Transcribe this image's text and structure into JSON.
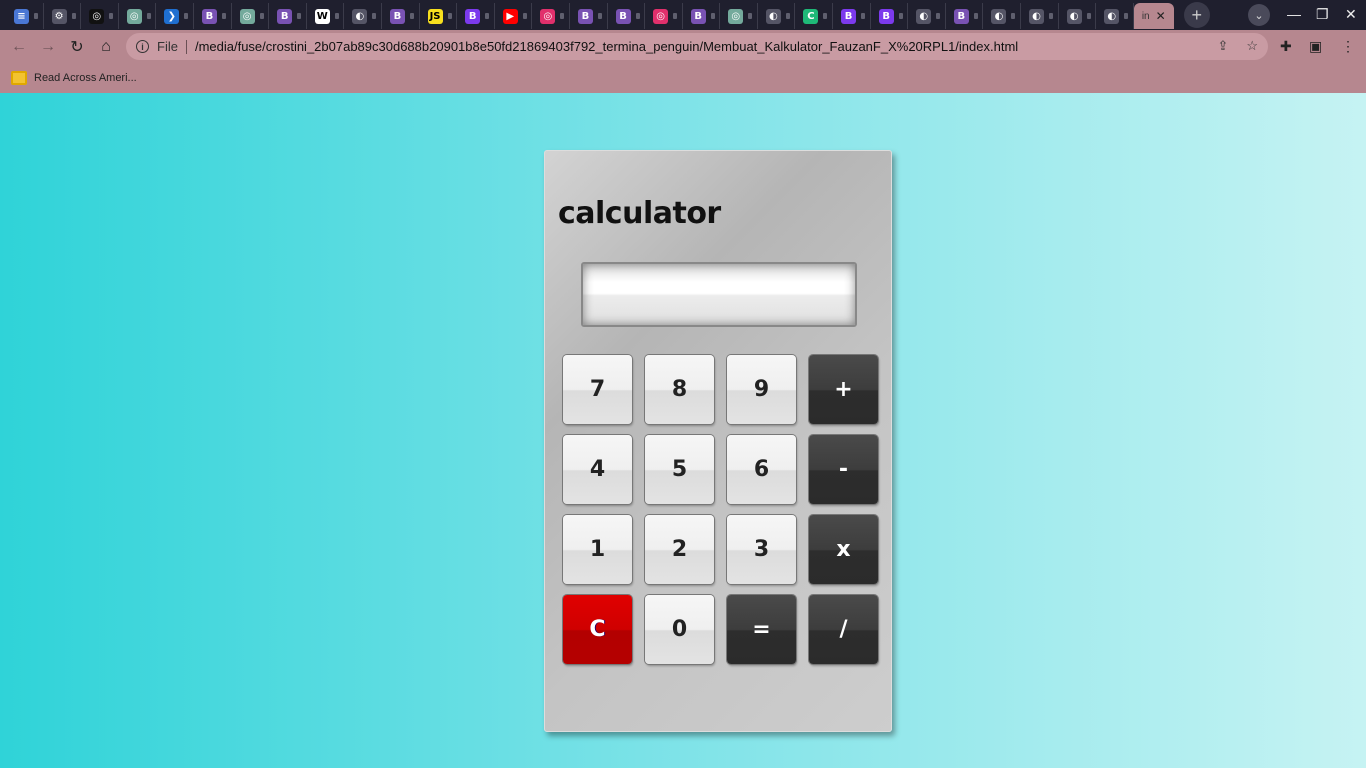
{
  "browser": {
    "tabs": [
      {
        "icon": "bookmark-app-icon",
        "color": "#4a77d4",
        "glyph": "≡"
      },
      {
        "icon": "settings-icon",
        "color": "#555566",
        "glyph": "⚙"
      },
      {
        "icon": "chatgpt-icon",
        "color": "#111111",
        "glyph": "◎"
      },
      {
        "icon": "chatgpt-icon",
        "color": "#74aa9c",
        "glyph": "◎"
      },
      {
        "icon": "flutter-icon",
        "color": "#1f6fd0",
        "glyph": "❯"
      },
      {
        "icon": "bootstrap-icon",
        "color": "#7952b3",
        "glyph": "B"
      },
      {
        "icon": "chatgpt-icon",
        "color": "#74aa9c",
        "glyph": "◎"
      },
      {
        "icon": "bootstrap-icon",
        "color": "#7952b3",
        "glyph": "B"
      },
      {
        "icon": "wikipedia-icon",
        "color": "#ffffff",
        "glyph": "W"
      },
      {
        "icon": "globe-icon",
        "color": "#555566",
        "glyph": "◐"
      },
      {
        "icon": "bootstrap-icon",
        "color": "#7952b3",
        "glyph": "B"
      },
      {
        "icon": "javascript-icon",
        "color": "#f7df1e",
        "glyph": "JS"
      },
      {
        "icon": "bootstrap-icon",
        "color": "#7c3aed",
        "glyph": "B"
      },
      {
        "icon": "youtube-icon",
        "color": "#ff0000",
        "glyph": "▶"
      },
      {
        "icon": "instagram-icon",
        "color": "#e1306c",
        "glyph": "◎"
      },
      {
        "icon": "bootstrap-icon",
        "color": "#7952b3",
        "glyph": "B"
      },
      {
        "icon": "bootstrap-icon",
        "color": "#7952b3",
        "glyph": "B"
      },
      {
        "icon": "instagram-icon",
        "color": "#e1306c",
        "glyph": "◎"
      },
      {
        "icon": "bootstrap-icon",
        "color": "#7952b3",
        "glyph": "B"
      },
      {
        "icon": "chatgpt-icon",
        "color": "#74aa9c",
        "glyph": "◎"
      },
      {
        "icon": "globe-icon",
        "color": "#555566",
        "glyph": "◐"
      },
      {
        "icon": "canva-icon",
        "color": "#1fb978",
        "glyph": "C"
      },
      {
        "icon": "bootstrap-icon",
        "color": "#7c3aed",
        "glyph": "B"
      },
      {
        "icon": "bootstrap-icon",
        "color": "#7c3aed",
        "glyph": "B"
      },
      {
        "icon": "globe-icon",
        "color": "#555566",
        "glyph": "◐"
      },
      {
        "icon": "bootstrap-icon",
        "color": "#7952b3",
        "glyph": "B"
      },
      {
        "icon": "globe-icon",
        "color": "#555566",
        "glyph": "◐"
      },
      {
        "icon": "globe-icon",
        "color": "#555566",
        "glyph": "◐"
      },
      {
        "icon": "globe-icon",
        "color": "#555566",
        "glyph": "◐"
      },
      {
        "icon": "globe-icon",
        "color": "#555566",
        "glyph": "◐"
      }
    ],
    "active_tab_title": "in",
    "address": {
      "scheme_label": "File",
      "url": "/media/fuse/crostini_2b07ab89c30d688b20901b8e50fd21869403f792_termina_penguin/Membuat_Kalkulator_FauzanF_X%20RPL1/index.html"
    },
    "bookmarks": [
      {
        "label": "Read Across Ameri..."
      }
    ]
  },
  "calculator": {
    "title": "calculator",
    "display_value": "",
    "keys": [
      {
        "label": "7",
        "style": "light"
      },
      {
        "label": "8",
        "style": "light"
      },
      {
        "label": "9",
        "style": "light"
      },
      {
        "label": "+",
        "style": "dark"
      },
      {
        "label": "4",
        "style": "light"
      },
      {
        "label": "5",
        "style": "light"
      },
      {
        "label": "6",
        "style": "light"
      },
      {
        "label": "-",
        "style": "dark"
      },
      {
        "label": "1",
        "style": "light"
      },
      {
        "label": "2",
        "style": "light"
      },
      {
        "label": "3",
        "style": "light"
      },
      {
        "label": "x",
        "style": "dark"
      },
      {
        "label": "C",
        "style": "red"
      },
      {
        "label": "0",
        "style": "light"
      },
      {
        "label": "=",
        "style": "dark"
      },
      {
        "label": "/",
        "style": "dark"
      }
    ]
  }
}
